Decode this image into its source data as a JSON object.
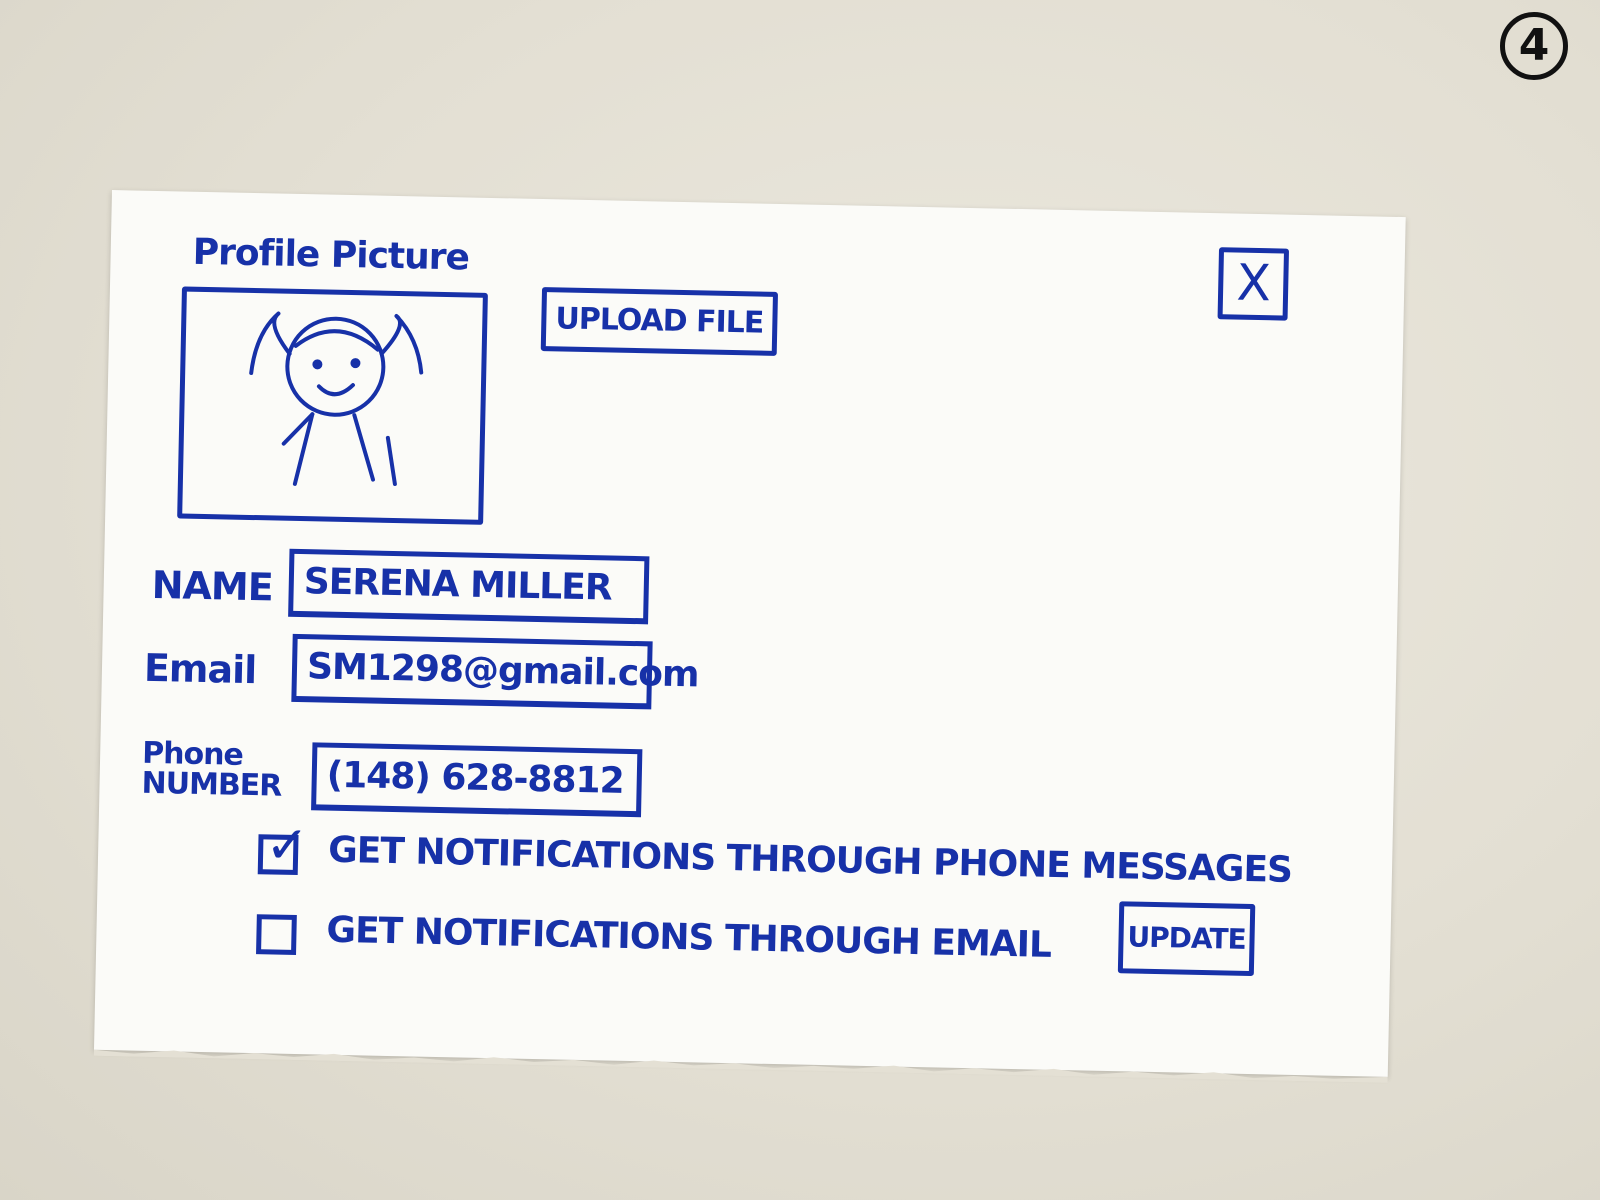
{
  "sketch_number": "4",
  "profile": {
    "title": "Profile Picture",
    "upload_label": "UPLOAD FILE",
    "close_label": "X"
  },
  "form": {
    "name_label": "NAME",
    "name_value": "SERENA MILLER",
    "email_label": "Email",
    "email_value": "SM1298@gmail.com",
    "phone_label": "Phone NUMBER",
    "phone_value": "(148) 628-8812"
  },
  "notifications": {
    "phone": {
      "label": "GET NOTIFICATIONS THROUGH PHONE MESSAGES",
      "checked": true
    },
    "email": {
      "label": "GET NOTIFICATIONS THROUGH EMAIL",
      "checked": false
    }
  },
  "update_label": "UPDATE",
  "colors": {
    "ink": "#1731a8",
    "paper": "#fbfbf8",
    "table": "#e4e0d4"
  }
}
